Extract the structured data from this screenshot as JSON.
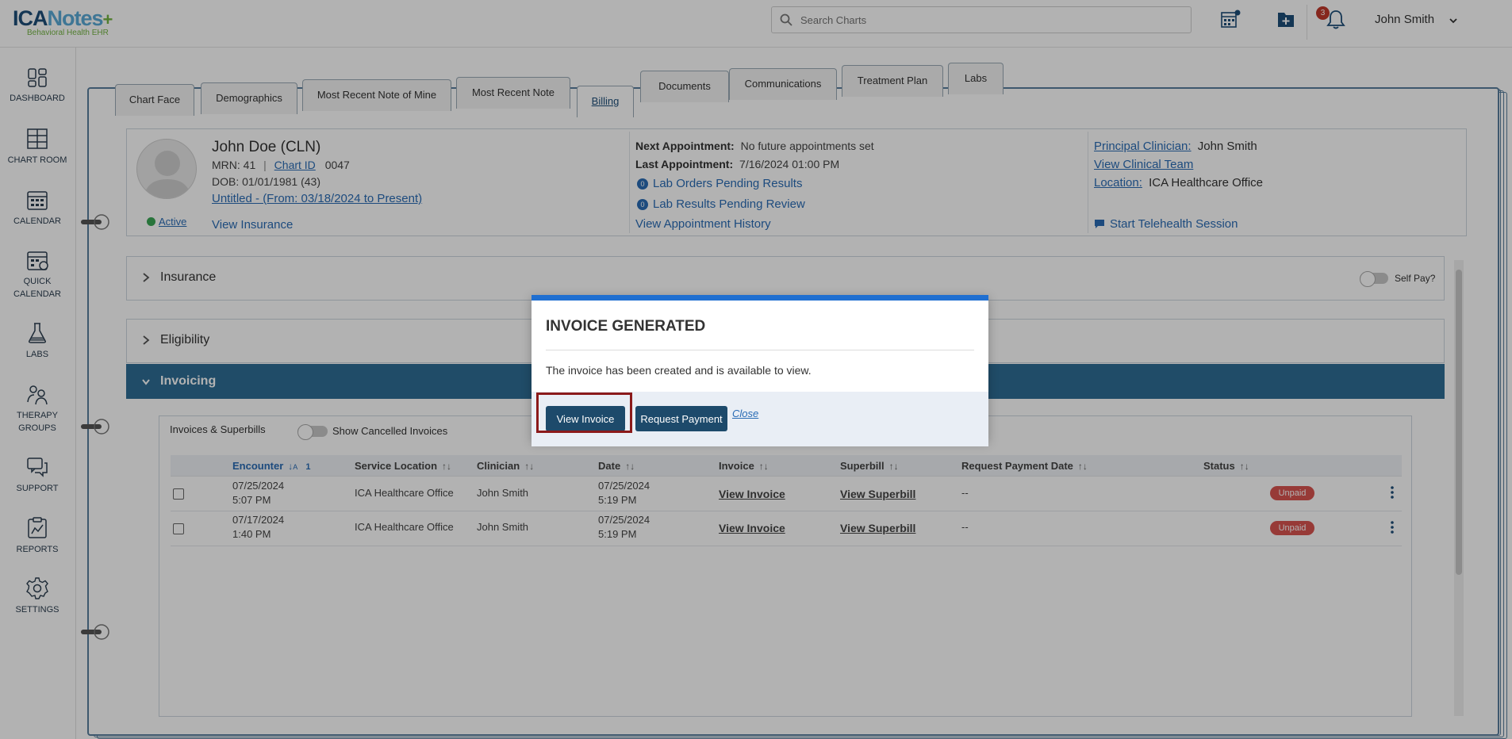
{
  "header": {
    "logo": {
      "ica": "ICA",
      "notes": "Notes",
      "plus": "+",
      "tagline": "Behavioral Health EHR"
    },
    "search_placeholder": "Search Charts",
    "notification_count": "3",
    "user_name": "John Smith"
  },
  "sidebar": {
    "items": [
      {
        "label": "DASHBOARD"
      },
      {
        "label": "CHART ROOM"
      },
      {
        "label": "CALENDAR"
      },
      {
        "label": "QUICK CALENDAR"
      },
      {
        "label": "LABS"
      },
      {
        "label": "THERAPY GROUPS"
      },
      {
        "label": "SUPPORT"
      },
      {
        "label": "REPORTS"
      },
      {
        "label": "SETTINGS"
      }
    ]
  },
  "tabs": [
    {
      "label": "Chart Face"
    },
    {
      "label": "Demographics"
    },
    {
      "label": "Most Recent Note of Mine"
    },
    {
      "label": "Most Recent Note"
    },
    {
      "label": "Billing"
    },
    {
      "label": "Documents"
    },
    {
      "label": "Communications"
    },
    {
      "label": "Treatment Plan"
    },
    {
      "label": "Labs"
    }
  ],
  "patient": {
    "name": "John Doe (CLN)",
    "mrn_label": "MRN:",
    "mrn": "41",
    "chart_id_label": "Chart ID",
    "chart_id": "0047",
    "dob_label": "DOB:",
    "dob": "01/01/1981 (43)",
    "episode": "Untitled - (From: 03/18/2024 to Present)",
    "status": "Active",
    "view_insurance": "View Insurance",
    "next_appt_label": "Next Appointment:",
    "next_appt": "No future appointments set",
    "last_appt_label": "Last Appointment:",
    "last_appt": "7/16/2024 01:00 PM",
    "lab_orders_count": "0",
    "lab_orders": "Lab Orders Pending Results",
    "lab_results_count": "0",
    "lab_results": "Lab Results Pending Review",
    "appt_history": "View Appointment History",
    "principal_label": "Principal Clinician:",
    "principal": "John Smith",
    "clinical_team": "View Clinical Team",
    "location_label": "Location:",
    "location": "ICA Healthcare Office",
    "telehealth": "Start Telehealth Session"
  },
  "sections": {
    "insurance": "Insurance",
    "self_pay": "Self Pay?",
    "eligibility": "Eligibility",
    "invoicing": "Invoicing"
  },
  "invoices": {
    "heading": "Invoices & Superbills",
    "show_cancelled": "Show Cancelled Invoices",
    "sort_order": "1",
    "columns": [
      "Encounter",
      "Service Location",
      "Clinician",
      "Date",
      "Invoice",
      "Superbill",
      "Request Payment Date",
      "Status"
    ],
    "rows": [
      {
        "enc_date": "07/25/2024",
        "enc_time": "5:07 PM",
        "location": "ICA Healthcare Office",
        "clinician": "John Smith",
        "date": "07/25/2024",
        "time": "5:19 PM",
        "invoice": "View Invoice",
        "superbill": "View Superbill",
        "req_date": "--",
        "status": "Unpaid"
      },
      {
        "enc_date": "07/17/2024",
        "enc_time": "1:40 PM",
        "location": "ICA Healthcare Office",
        "clinician": "John Smith",
        "date": "07/25/2024",
        "time": "5:19 PM",
        "invoice": "View Invoice",
        "superbill": "View Superbill",
        "req_date": "--",
        "status": "Unpaid"
      }
    ]
  },
  "modal": {
    "title": "INVOICE GENERATED",
    "message": "The invoice has been created and is available to view.",
    "view_invoice": "View Invoice",
    "request_payment": "Request Payment",
    "close": "Close"
  },
  "colors": {
    "brand_blue": "#1e4e79",
    "accent_green": "#73b443",
    "invoicing_bar": "#2e6e96",
    "modal_top": "#1f6fd1",
    "button": "#1d4a6b",
    "unpaid": "#d9534f"
  }
}
